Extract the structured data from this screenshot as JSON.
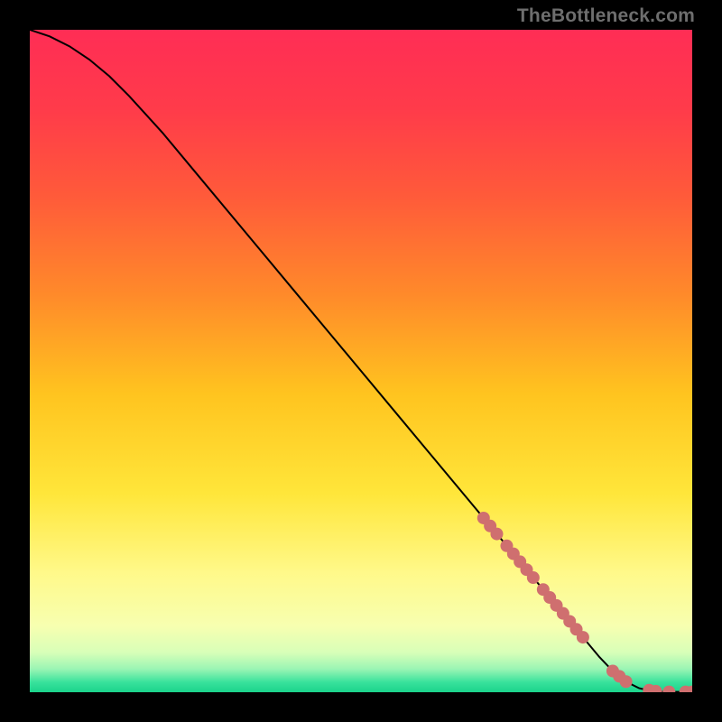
{
  "watermark": "TheBottleneck.com",
  "palette": {
    "curve_stroke": "#000000",
    "marker_fill": "#cf6f6f",
    "frame_bg": "#000000"
  },
  "chart_data": {
    "type": "line",
    "title": "",
    "xlabel": "",
    "ylabel": "",
    "xlim": [
      0,
      100
    ],
    "ylim": [
      0,
      100
    ],
    "grid": false,
    "legend": false,
    "background_gradient_stops": [
      {
        "offset": 0.0,
        "color": "#ff2d55"
      },
      {
        "offset": 0.12,
        "color": "#ff3b4a"
      },
      {
        "offset": 0.25,
        "color": "#ff5a3a"
      },
      {
        "offset": 0.4,
        "color": "#ff8a2a"
      },
      {
        "offset": 0.55,
        "color": "#ffc41f"
      },
      {
        "offset": 0.7,
        "color": "#ffe63a"
      },
      {
        "offset": 0.82,
        "color": "#fff98a"
      },
      {
        "offset": 0.9,
        "color": "#f7ffb0"
      },
      {
        "offset": 0.94,
        "color": "#d8ffb8"
      },
      {
        "offset": 0.965,
        "color": "#9af5b4"
      },
      {
        "offset": 0.985,
        "color": "#38e29c"
      },
      {
        "offset": 1.0,
        "color": "#1bd38b"
      }
    ],
    "series": [
      {
        "name": "curve",
        "x": [
          0,
          3,
          6,
          9,
          12,
          15,
          20,
          25,
          30,
          35,
          40,
          45,
          50,
          55,
          60,
          65,
          70,
          73,
          75,
          78,
          80,
          82,
          84,
          86,
          88,
          90,
          92,
          94,
          96,
          97,
          98,
          100
        ],
        "y": [
          100,
          99,
          97.5,
          95.5,
          93,
          90,
          84.5,
          78.5,
          72.5,
          66.5,
          60.5,
          54.5,
          48.5,
          42.5,
          36.5,
          30.5,
          24.5,
          20.9,
          18.5,
          14.9,
          12.5,
          10.1,
          7.7,
          5.3,
          3.2,
          1.6,
          0.6,
          0.15,
          0.05,
          0.05,
          0.05,
          0.05
        ]
      }
    ],
    "markers": {
      "name": "highlight-dots",
      "x": [
        68.5,
        69.5,
        70.5,
        72.0,
        73.0,
        74.0,
        75.0,
        76.0,
        77.5,
        78.5,
        79.5,
        80.5,
        81.5,
        82.5,
        83.5,
        88.0,
        89.0,
        90.0,
        93.5,
        94.5,
        96.5,
        99.0,
        100.0
      ],
      "y": [
        26.3,
        25.1,
        23.9,
        22.1,
        20.9,
        19.7,
        18.5,
        17.3,
        15.5,
        14.3,
        13.1,
        11.9,
        10.7,
        9.5,
        8.3,
        3.2,
        2.4,
        1.6,
        0.3,
        0.15,
        0.05,
        0.05,
        0.05
      ]
    }
  }
}
